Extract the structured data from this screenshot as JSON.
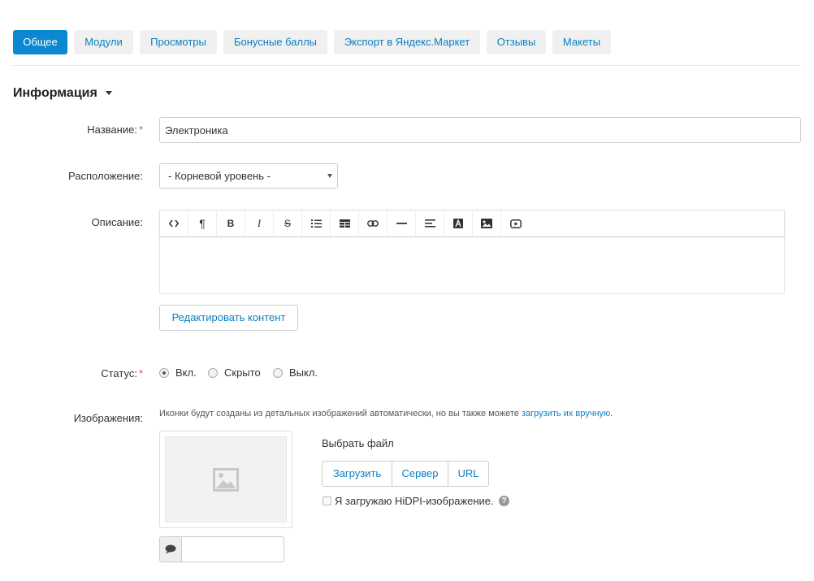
{
  "tabs": [
    {
      "label": "Общее",
      "active": true
    },
    {
      "label": "Модули",
      "active": false
    },
    {
      "label": "Просмотры",
      "active": false
    },
    {
      "label": "Бонусные баллы",
      "active": false
    },
    {
      "label": "Экспорт в Яндекс.Маркет",
      "active": false
    },
    {
      "label": "Отзывы",
      "active": false
    },
    {
      "label": "Макеты",
      "active": false
    }
  ],
  "section": {
    "title": "Информация"
  },
  "form": {
    "name": {
      "label": "Название:",
      "required_mark": "*",
      "value": "Электроника"
    },
    "location": {
      "label": "Расположение:",
      "selected": "- Корневой уровень -"
    },
    "description": {
      "label": "Описание:",
      "toolbar_icons": [
        "code-icon",
        "paragraph-icon",
        "bold-icon",
        "italic-icon",
        "strikethrough-icon",
        "unordered-list-icon",
        "table-icon",
        "link-icon",
        "horizontal-rule-icon",
        "align-icon",
        "font-color-icon",
        "image-icon",
        "video-icon"
      ],
      "edit_button": "Редактировать контент"
    },
    "status": {
      "label": "Статус:",
      "required_mark": "*",
      "options": [
        {
          "label": "Вкл.",
          "checked": true
        },
        {
          "label": "Скрыто",
          "checked": false
        },
        {
          "label": "Выкл.",
          "checked": false
        }
      ]
    },
    "images": {
      "label": "Изображения:",
      "hint_text": "Иконки будут созданы из детальных изображений автоматически, но вы также можете ",
      "hint_link": "загрузить их вручную",
      "hint_end": ".",
      "choose_file": "Выбрать файл",
      "buttons": [
        "Загрузить",
        "Сервер",
        "URL"
      ],
      "hidpi_label": "Я загружаю HiDPI-изображение.",
      "hidpi_checked": false,
      "help_glyph": "?",
      "alt_value": ""
    }
  },
  "colors": {
    "accent": "#0b88d1",
    "link": "#0b7fc0",
    "required": "#d9534f"
  }
}
